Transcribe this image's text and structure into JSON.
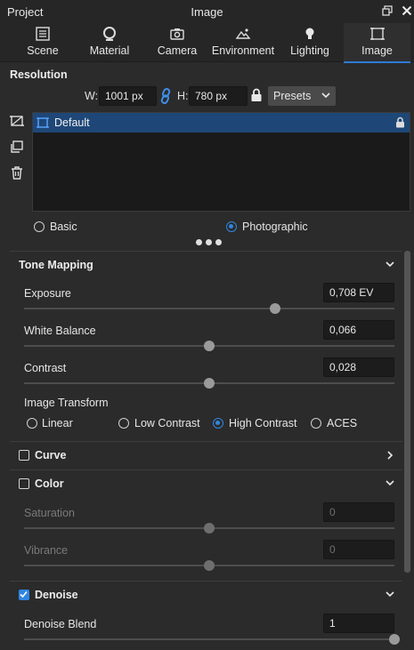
{
  "window": {
    "left_title": "Project",
    "title": "Image",
    "restore_icon": "restore-window-icon",
    "close_icon": "close-icon"
  },
  "tabs": [
    {
      "label": "Scene",
      "icon": "scene-list-icon"
    },
    {
      "label": "Material",
      "icon": "material-sphere-icon"
    },
    {
      "label": "Camera",
      "icon": "camera-icon"
    },
    {
      "label": "Environment",
      "icon": "environment-icon"
    },
    {
      "label": "Lighting",
      "icon": "light-bulb-icon"
    },
    {
      "label": "Image",
      "icon": "image-frame-icon",
      "active": true
    }
  ],
  "resolution": {
    "section_label": "Resolution",
    "width_label": "W:",
    "width_value": "1001 px",
    "height_label": "H:",
    "height_value": "780 px",
    "presets_label": "Presets"
  },
  "presets": {
    "items": [
      {
        "name": "Default",
        "selected": true,
        "locked": true
      }
    ]
  },
  "mode": {
    "options": [
      "Basic",
      "Photographic"
    ],
    "selected": "Photographic"
  },
  "tone_mapping": {
    "title": "Tone Mapping",
    "expanded": true,
    "params": [
      {
        "label": "Exposure",
        "value": "0,708 EV",
        "slider": 0.678
      },
      {
        "label": "White Balance",
        "value": "0,066",
        "slider": 0.5
      },
      {
        "label": "Contrast",
        "value": "0,028",
        "slider": 0.5
      }
    ],
    "transform_label": "Image Transform",
    "transform_options": [
      "Linear",
      "Low Contrast",
      "High Contrast",
      "ACES"
    ],
    "transform_selected": "High Contrast"
  },
  "curve": {
    "title": "Curve",
    "checked": false,
    "expanded": false
  },
  "color": {
    "title": "Color",
    "checked": false,
    "expanded": true,
    "params": [
      {
        "label": "Saturation",
        "value": "0",
        "slider": 0.5
      },
      {
        "label": "Vibrance",
        "value": "0",
        "slider": 0.5
      }
    ]
  },
  "denoise": {
    "title": "Denoise",
    "checked": true,
    "expanded": true,
    "params": [
      {
        "label": "Denoise Blend",
        "value": "1",
        "slider": 1.0
      }
    ]
  },
  "colors": {
    "accent": "#2f86e0",
    "selection": "#1e4778",
    "panel": "#2b2b2b"
  }
}
